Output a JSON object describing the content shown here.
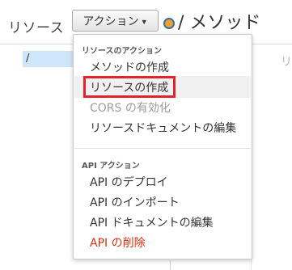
{
  "header": {
    "resources_title": "リソース",
    "actions_label": "アクション",
    "caret_icon": "caret-down-icon",
    "methods_title": "/ メソッド"
  },
  "tree": {
    "selected_resource": "/",
    "right_fragment": "リ"
  },
  "menu": {
    "resource_section": {
      "header": "リソースのアクション",
      "items": [
        "メソッドの作成",
        "リソースの作成",
        "CORS の有効化",
        "リソースドキュメントの編集"
      ],
      "highlighted_index": 1,
      "disabled_index": 2
    },
    "api_section": {
      "header": "API アクション",
      "items": [
        "API のデプロイ",
        "API のインポート",
        "API ドキュメントの編集",
        "API の削除"
      ],
      "danger_index": 3
    }
  },
  "colors": {
    "highlight_box": "#e32229",
    "danger_text": "#d13212",
    "selected_resource_bg": "#cfe6f9",
    "method_dot_fill": "#f0a12b"
  }
}
